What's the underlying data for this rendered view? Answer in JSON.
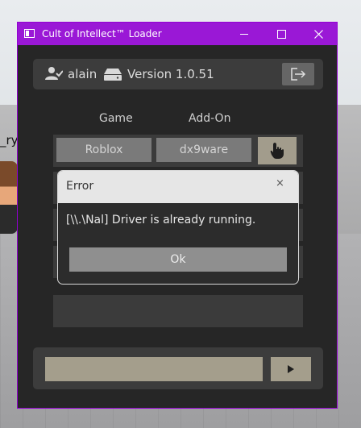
{
  "window": {
    "title": "Cult of Intellect™ Loader"
  },
  "header": {
    "username": "alain",
    "version": "Version 1.0.51"
  },
  "columns": {
    "game": "Game",
    "addon": "Add-On"
  },
  "selection": {
    "game": "Roblox",
    "addon": "dx9ware"
  },
  "dialog": {
    "title": "Error",
    "close_label": "×",
    "message": "[\\\\.\\Nal] Driver is already running.",
    "ok_label": "Ok"
  },
  "background": {
    "player_name_fragment": "_ry"
  },
  "colors": {
    "titlebar": "#9a18d6",
    "window_bg": "#262626",
    "accent_tan": "#a49e8c"
  }
}
